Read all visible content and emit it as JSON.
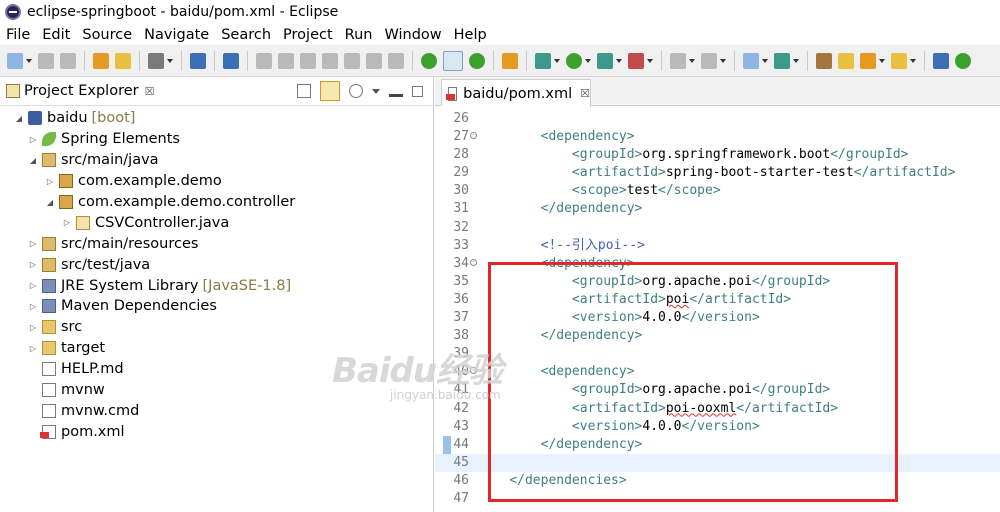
{
  "window": {
    "title": "eclipse-springboot - baidu/pom.xml - Eclipse"
  },
  "menu": [
    "File",
    "Edit",
    "Source",
    "Navigate",
    "Search",
    "Project",
    "Run",
    "Window",
    "Help"
  ],
  "project_explorer": {
    "title": "Project Explorer",
    "close_glyph": "☒",
    "tree": [
      {
        "label": "baidu",
        "decoration": "[boot]",
        "expanded": "open"
      },
      {
        "label": "Spring Elements",
        "expanded": "closed"
      },
      {
        "label": "src/main/java",
        "expanded": "open"
      },
      {
        "label": "com.example.demo",
        "expanded": "closed"
      },
      {
        "label": "com.example.demo.controller",
        "expanded": "open"
      },
      {
        "label": "CSVController.java",
        "expanded": "closed"
      },
      {
        "label": "src/main/resources",
        "expanded": "closed"
      },
      {
        "label": "src/test/java",
        "expanded": "closed"
      },
      {
        "label": "JRE System Library",
        "decoration": "[JavaSE-1.8]",
        "expanded": "closed"
      },
      {
        "label": "Maven Dependencies",
        "expanded": "closed"
      },
      {
        "label": "src",
        "expanded": "closed"
      },
      {
        "label": "target",
        "expanded": "closed"
      },
      {
        "label": "HELP.md",
        "expanded": "none"
      },
      {
        "label": "mvnw",
        "expanded": "none"
      },
      {
        "label": "mvnw.cmd",
        "expanded": "none"
      },
      {
        "label": "pom.xml",
        "expanded": "none"
      }
    ]
  },
  "editor": {
    "tab_label": "baidu/pom.xml",
    "close_glyph": "☒",
    "lines": [
      {
        "n": "26",
        "text": ""
      },
      {
        "n": "27",
        "text": "        <dependency>",
        "fold": true
      },
      {
        "n": "28",
        "text": "            <groupId>org.springframework.boot</groupId>"
      },
      {
        "n": "29",
        "text": "            <artifactId>spring-boot-starter-test</artifactId>"
      },
      {
        "n": "30",
        "text": "            <scope>test</scope>"
      },
      {
        "n": "31",
        "text": "        </dependency>"
      },
      {
        "n": "32",
        "text": ""
      },
      {
        "n": "33",
        "text": "        <!--引入poi-->"
      },
      {
        "n": "34",
        "text": "        <dependency>",
        "fold": true
      },
      {
        "n": "35",
        "text": "            <groupId>org.apache.poi</groupId>"
      },
      {
        "n": "36",
        "text": "            <artifactId>poi</artifactId>"
      },
      {
        "n": "37",
        "text": "            <version>4.0.0</version>"
      },
      {
        "n": "38",
        "text": "        </dependency>"
      },
      {
        "n": "39",
        "text": ""
      },
      {
        "n": "40",
        "text": "        <dependency>",
        "fold": true
      },
      {
        "n": "41",
        "text": "            <groupId>org.apache.poi</groupId>"
      },
      {
        "n": "42",
        "text": "            <artifactId>poi-ooxml</artifactId>"
      },
      {
        "n": "43",
        "text": "            <version>4.0.0</version>"
      },
      {
        "n": "44",
        "text": "        </dependency>"
      },
      {
        "n": "45",
        "text": "",
        "current": true
      },
      {
        "n": "46",
        "text": "    </dependencies>"
      },
      {
        "n": "47",
        "text": ""
      }
    ]
  },
  "watermark": {
    "main": "Baidu经验",
    "sub": "jingyan.baidu.com"
  },
  "colors": {
    "highlight_box": "#e0272b",
    "xml_tag": "#3f7f7f",
    "comment": "#3f5fbf"
  }
}
